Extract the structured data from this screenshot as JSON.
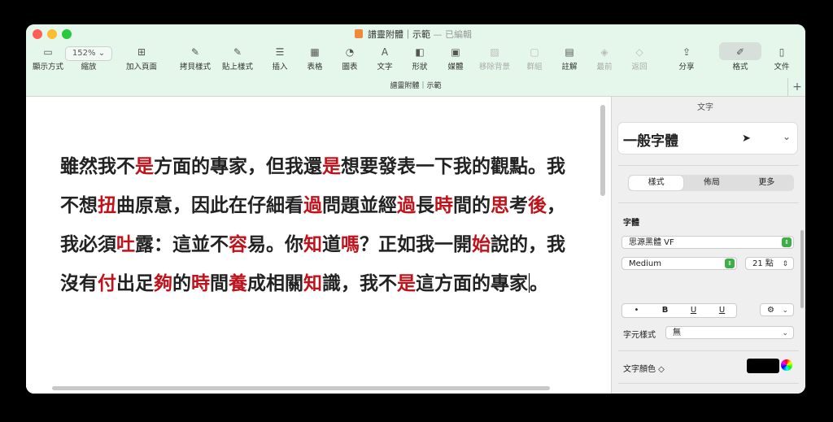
{
  "window": {
    "title": "譜靈附體｜示範",
    "title_suffix": "— 已編輯",
    "subtitle": "譜靈附體｜示範"
  },
  "toolbar": {
    "zoom_value": "152%",
    "items": [
      {
        "label": "顯示方式",
        "icon": "view-icon",
        "glyph": "▭"
      },
      {
        "label": "縮放",
        "icon": "zoom-icon",
        "glyph": ""
      },
      {
        "label": "加入頁面",
        "icon": "add-page-icon",
        "glyph": "⊞"
      },
      {
        "label": "拷貝樣式",
        "icon": "copy-style-icon",
        "glyph": "✎"
      },
      {
        "label": "貼上樣式",
        "icon": "paste-style-icon",
        "glyph": "✎"
      },
      {
        "label": "插入",
        "icon": "insert-icon",
        "glyph": "☰"
      },
      {
        "label": "表格",
        "icon": "table-icon",
        "glyph": "▦"
      },
      {
        "label": "圖表",
        "icon": "chart-icon",
        "glyph": "◔"
      },
      {
        "label": "文字",
        "icon": "text-icon",
        "glyph": "A"
      },
      {
        "label": "形狀",
        "icon": "shape-icon",
        "glyph": "◧"
      },
      {
        "label": "媒體",
        "icon": "media-icon",
        "glyph": "▣"
      },
      {
        "label": "移除背景",
        "icon": "remove-bg-icon",
        "glyph": "▨"
      },
      {
        "label": "群組",
        "icon": "group-icon",
        "glyph": "▢"
      },
      {
        "label": "註解",
        "icon": "comment-icon",
        "glyph": "▤"
      },
      {
        "label": "最前",
        "icon": "front-icon",
        "glyph": "◈"
      },
      {
        "label": "返回",
        "icon": "back-icon",
        "glyph": "◇"
      },
      {
        "label": "分享",
        "icon": "share-icon",
        "glyph": "⇪"
      },
      {
        "label": "格式",
        "icon": "format-brush-icon",
        "glyph": "✐"
      },
      {
        "label": "文件",
        "icon": "document-icon",
        "glyph": "▯"
      }
    ]
  },
  "document": {
    "segments": [
      {
        "t": "雖然我不",
        "h": false
      },
      {
        "t": "是",
        "h": true
      },
      {
        "t": "方面的專家，但我還",
        "h": false
      },
      {
        "t": "是",
        "h": true
      },
      {
        "t": "想要發表一下我的觀點。我不想",
        "h": false
      },
      {
        "t": "扭",
        "h": true
      },
      {
        "t": "曲原意，因此在仔細看",
        "h": false
      },
      {
        "t": "過",
        "h": true
      },
      {
        "t": "問題並經",
        "h": false
      },
      {
        "t": "過",
        "h": true
      },
      {
        "t": "長",
        "h": false
      },
      {
        "t": "時",
        "h": true
      },
      {
        "t": "間的",
        "h": false
      },
      {
        "t": "思",
        "h": true
      },
      {
        "t": "考",
        "h": false
      },
      {
        "t": "後",
        "h": true
      },
      {
        "t": "，我必須",
        "h": false
      },
      {
        "t": "吐",
        "h": true
      },
      {
        "t": "露：這並不",
        "h": false
      },
      {
        "t": "容",
        "h": true
      },
      {
        "t": "易。你",
        "h": false
      },
      {
        "t": "知",
        "h": true
      },
      {
        "t": "道",
        "h": false
      },
      {
        "t": "嗎",
        "h": true
      },
      {
        "t": "？正如我一開",
        "h": false
      },
      {
        "t": "始",
        "h": true
      },
      {
        "t": "說的，我沒有",
        "h": false
      },
      {
        "t": "付",
        "h": true
      },
      {
        "t": "出足",
        "h": false
      },
      {
        "t": "夠",
        "h": true
      },
      {
        "t": "的",
        "h": false
      },
      {
        "t": "時",
        "h": true
      },
      {
        "t": "間",
        "h": false
      },
      {
        "t": "養",
        "h": true
      },
      {
        "t": "成相關",
        "h": false
      },
      {
        "t": "知",
        "h": true
      },
      {
        "t": "識，我不",
        "h": false
      },
      {
        "t": "是",
        "h": true
      },
      {
        "t": "這方面的專家",
        "h": false
      }
    ],
    "highlight_color": "#c0121a"
  },
  "sidebar": {
    "title": "文字",
    "paragraph_style": "一般字體",
    "tabs": [
      "樣式",
      "佈局",
      "更多"
    ],
    "active_tab": "樣式",
    "font_section_label": "字體",
    "font_family": "思源黑體 VF",
    "font_weight": "Medium",
    "font_size": "21 點",
    "style_buttons": [
      "•",
      "B",
      "U",
      "U"
    ],
    "char_style_label": "字元樣式",
    "char_style_value": "無",
    "text_color_label": "文字顏色 ◇",
    "text_color": "#000000",
    "accent_color": "#3fae49",
    "alignment_icons": [
      "align-left-icon",
      "align-center-icon",
      "align-right-icon",
      "justify-icon"
    ]
  }
}
